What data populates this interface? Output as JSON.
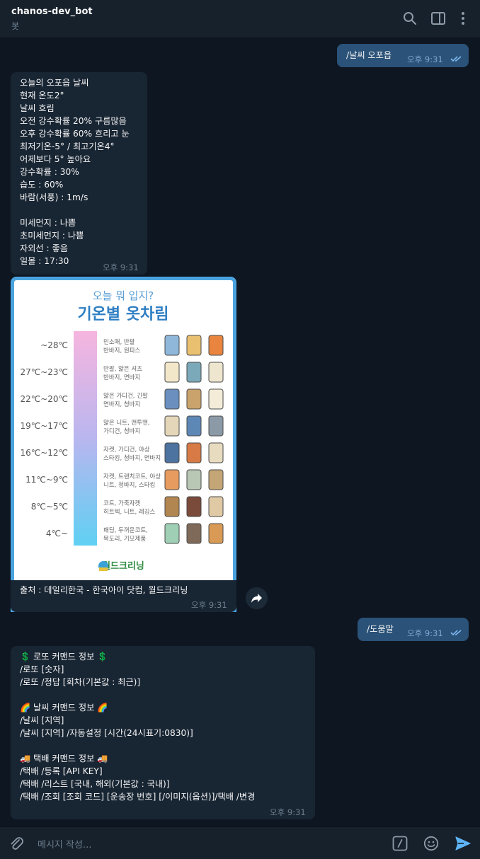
{
  "header": {
    "title": "chanos-dev_bot",
    "subtitle": "봇"
  },
  "messages": {
    "m1": {
      "text": "/날씨 오포읍",
      "time": "오후 9:31"
    },
    "m2": {
      "lines": [
        "오늘의 오포읍 날씨",
        "현재 온도2°",
        "날씨 흐림",
        "오전 강수확률 20% 구름많음",
        "오후 강수확률 60% 흐리고 눈",
        "최저기온-5° / 최고기온4°",
        "어제보다 5° 높아요",
        "강수확률 : 30%",
        "습도 : 60%",
        "바람(서풍) : 1m/s",
        "",
        "미세먼지 : 나쁨",
        "초미세먼지 : 나쁨",
        "자외선 : 좋음",
        "일몰 : 17:30"
      ],
      "time": "오후 9:31"
    },
    "m3": {
      "image": {
        "subtitle": "오늘 뭐 입지?",
        "title": "기온별 옷차림",
        "rows": [
          {
            "temp": "~28℃",
            "desc1": "민소매, 반팔",
            "desc2": "반바지, 원피스"
          },
          {
            "temp": "27℃~23℃",
            "desc1": "반팔, 얇은 셔츠",
            "desc2": "반바지, 면바지"
          },
          {
            "temp": "22℃~20℃",
            "desc1": "얇은 가디건, 긴팔",
            "desc2": "면바지, 청바지"
          },
          {
            "temp": "19℃~17℃",
            "desc1": "얇은 니트, 맨투맨,",
            "desc2": "가디건, 청바지"
          },
          {
            "temp": "16℃~12℃",
            "desc1": "자켓, 가디건, 야상",
            "desc2": "스타킹, 청바지, 면바지"
          },
          {
            "temp": "11℃~9℃",
            "desc1": "자켓, 트렌치코트, 야상",
            "desc2": "니트, 청바지, 스타킹"
          },
          {
            "temp": "8℃~5℃",
            "desc1": "코트, 가죽자켓",
            "desc2": "히트텍, 니트, 레깅스"
          },
          {
            "temp": "4℃~",
            "desc1": "패딩, 두꺼운코트,",
            "desc2": "목도리, 기모제품"
          }
        ],
        "brand": "월드크리닝"
      },
      "caption": "출처 : 데일리한국 - 한국아이 닷컴, 월드크리닝",
      "time": "오후 9:31"
    },
    "m4": {
      "text": "/도움말",
      "time": "오후 9:31"
    },
    "m5": {
      "lines": [
        "💲 로또 커맨드 정보 💲",
        "/로또 [숫자]",
        "/로또 /정답 [회차(기본값 : 최근)]",
        "",
        "🌈 날씨 커맨드 정보 🌈",
        "/날씨 [지역]",
        "/날씨 [지역] /자동설정 [시간(24시표기:0830)]",
        "",
        "🚚 택배 커맨드 정보 🚚",
        "/택배 /등록 [API KEY]",
        "/택배 /리스트 [국내, 해외(기본값 : 국내)]",
        "/택배 /조회 [조회 코드] [운송장 번호] [/이미지(옵션)]/택배 /변경"
      ],
      "time": "오후 9:31"
    }
  },
  "input": {
    "placeholder": "메시지 작성..."
  },
  "colors": {
    "background": "#0e1621",
    "header": "#17212b",
    "outgoing_bubble": "#2b5278",
    "incoming_bubble": "#182533",
    "accent": "#5eb5f7"
  },
  "icons": [
    "search-icon",
    "sidebar-toggle-icon",
    "more-vertical-icon",
    "share-icon",
    "attach-icon",
    "slash-command-icon",
    "emoji-icon",
    "send-icon",
    "read-check-icon"
  ]
}
